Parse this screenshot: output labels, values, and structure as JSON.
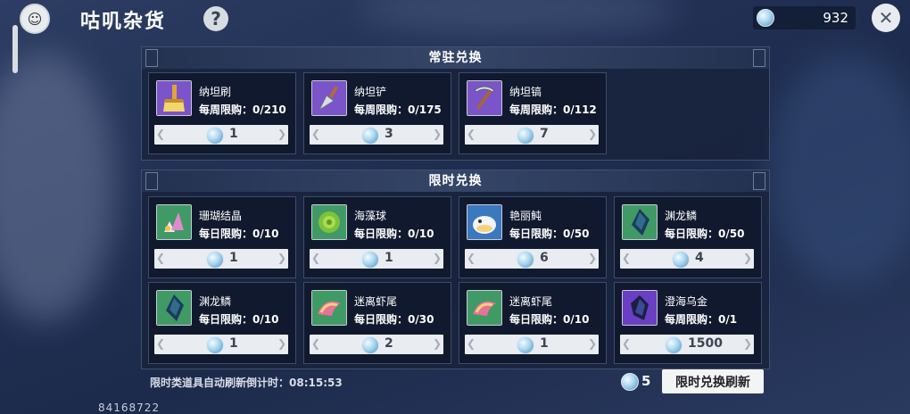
{
  "header": {
    "title": "咕叽杂货",
    "help_label": "?",
    "currency_value": "932",
    "close_label": "✕"
  },
  "permanent": {
    "title": "常驻兑换",
    "items": [
      {
        "name": "纳坦刷",
        "limit": "每周限购：0/210",
        "price": "1",
        "icon": "brush-icon"
      },
      {
        "name": "纳坦铲",
        "limit": "每周限购：0/175",
        "price": "3",
        "icon": "trowel-icon"
      },
      {
        "name": "纳坦镐",
        "limit": "每周限购：0/112",
        "price": "7",
        "icon": "pickaxe-icon"
      }
    ]
  },
  "limited": {
    "title": "限时兑换",
    "items": [
      {
        "name": "珊瑚结晶",
        "limit": "每日限购：0/10",
        "price": "1",
        "icon": "coral-crystal-icon"
      },
      {
        "name": "海藻球",
        "limit": "每日限购：0/10",
        "price": "1",
        "icon": "algae-ball-icon"
      },
      {
        "name": "艳丽鲀",
        "limit": "每日限购：0/50",
        "price": "6",
        "icon": "pufferfish-icon"
      },
      {
        "name": "渊龙鳞",
        "limit": "每日限购：0/50",
        "price": "4",
        "icon": "dragon-scale-icon"
      },
      {
        "name": "渊龙鳞",
        "limit": "每日限购：0/10",
        "price": "1",
        "icon": "dragon-scale-icon"
      },
      {
        "name": "迷离虾尾",
        "limit": "每日限购：0/30",
        "price": "2",
        "icon": "shrimp-tail-icon"
      },
      {
        "name": "迷离虾尾",
        "limit": "每日限购：0/10",
        "price": "1",
        "icon": "shrimp-tail-icon"
      },
      {
        "name": "澄海乌金",
        "limit": "每周限购：0/1",
        "price": "1500",
        "icon": "dark-gold-icon"
      }
    ]
  },
  "footer": {
    "countdown_text": "限时类道具自动刷新倒计时：08:15:53",
    "refresh_cost": "5",
    "refresh_button": "限时兑换刷新"
  },
  "uid": "84168722"
}
